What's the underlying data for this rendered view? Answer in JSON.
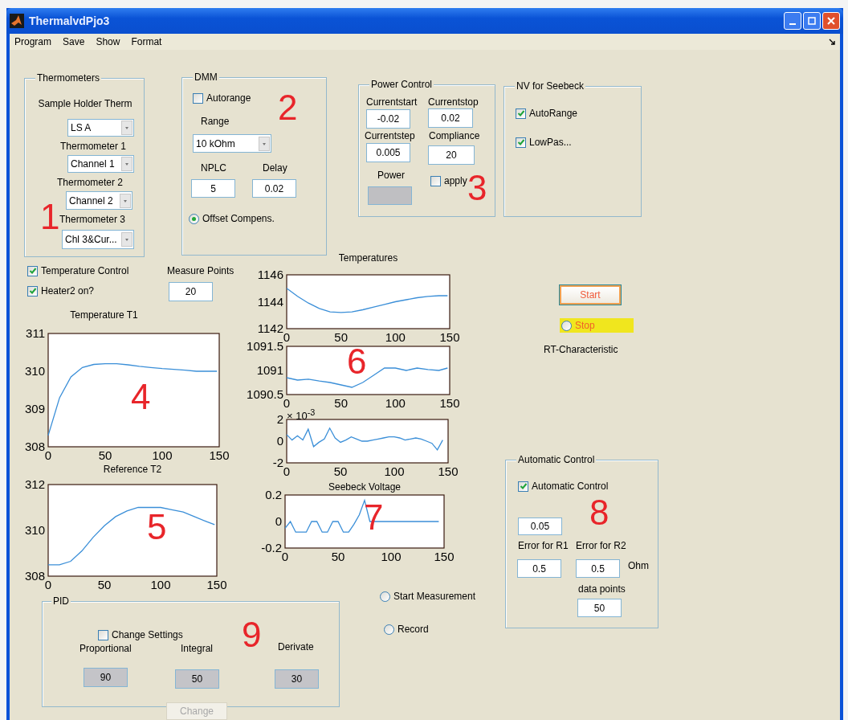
{
  "window": {
    "title": "ThermalvdPjo3"
  },
  "menu": [
    "Program",
    "Save",
    "Show",
    "Format"
  ],
  "thermometers": {
    "title": "Thermometers",
    "fields": [
      {
        "label": "Sample Holder Therm",
        "value": "LS A"
      },
      {
        "label": "Thermometer 1",
        "value": "Channel 1"
      },
      {
        "label": "Thermometer 2",
        "value": "Channel 2"
      },
      {
        "label": "Thermometer 3",
        "value": "Chl 3&Cur..."
      }
    ]
  },
  "dmm": {
    "title": "DMM",
    "autorange": {
      "label": "Autorange",
      "checked": false
    },
    "range": {
      "label": "Range",
      "value": "10 kOhm"
    },
    "nplc": {
      "label": "NPLC",
      "value": "5"
    },
    "delay": {
      "label": "Delay",
      "value": "0.02"
    },
    "offset": {
      "label": "Offset Compens.",
      "selected": true
    }
  },
  "power_control": {
    "title": "Power Control",
    "fields": [
      {
        "label": "Currentstart",
        "value": "-0.02"
      },
      {
        "label": "Currentstop",
        "value": "0.02"
      },
      {
        "label": "Currentstep",
        "value": "0.005"
      },
      {
        "label": "Compliance",
        "value": "20"
      }
    ],
    "power_label": "Power",
    "apply": {
      "label": "apply",
      "checked": false
    }
  },
  "nv_seebeck": {
    "title": "NV for Seebeck",
    "options": [
      {
        "label": "AutoRange",
        "checked": true
      },
      {
        "label": "LowPas...",
        "checked": true
      }
    ]
  },
  "temperature_control": {
    "label": "Temperature Control",
    "checked": true
  },
  "heater2": {
    "label": "Heater2 on?",
    "checked": true
  },
  "measure_points": {
    "label": "Measure Points",
    "value": "20"
  },
  "plots": [
    {
      "chart_data": {
        "type": "line",
        "title": "Temperature T1",
        "x": [
          0,
          10,
          20,
          30,
          40,
          50,
          60,
          70,
          80,
          90,
          100,
          110,
          120,
          130,
          140,
          148
        ],
        "series": [
          {
            "color": "#3b8fd8",
            "values": [
              308.3,
              309.3,
              309.85,
              310.1,
              310.18,
              310.2,
              310.2,
              310.17,
              310.13,
              310.1,
              310.07,
              310.05,
              310.03,
              310.0,
              310.0,
              310.0
            ]
          }
        ],
        "xlim": [
          0,
          150
        ],
        "ylim": [
          308,
          311
        ],
        "xticks": [
          0,
          50,
          100,
          150
        ],
        "yticks": [
          308,
          309,
          310,
          311
        ]
      }
    },
    {
      "chart_data": {
        "type": "line",
        "title": "Reference T2",
        "x": [
          0,
          10,
          20,
          30,
          40,
          50,
          60,
          70,
          80,
          90,
          100,
          110,
          120,
          130,
          140,
          148
        ],
        "series": [
          {
            "color": "#3b8fd8",
            "values": [
              308.5,
              308.5,
              308.65,
              309.1,
              309.7,
              310.2,
              310.6,
              310.85,
              311.0,
              311.0,
              311.0,
              310.9,
              310.8,
              310.6,
              310.4,
              310.25
            ]
          }
        ],
        "xlim": [
          0,
          150
        ],
        "ylim": [
          308,
          312
        ],
        "xticks": [
          0,
          50,
          100,
          150
        ],
        "yticks": [
          308,
          310,
          312
        ]
      }
    },
    {
      "chart_data": {
        "type": "line",
        "title": "Temperatures",
        "x": [
          0,
          10,
          20,
          30,
          40,
          50,
          60,
          70,
          80,
          90,
          100,
          110,
          120,
          130,
          140,
          148
        ],
        "series": [
          {
            "color": "#3b8fd8",
            "values": [
              1145.0,
              1144.4,
              1143.9,
              1143.5,
              1143.25,
              1143.2,
              1143.25,
              1143.4,
              1143.6,
              1143.8,
              1144.0,
              1144.15,
              1144.3,
              1144.4,
              1144.45,
              1144.45
            ]
          }
        ],
        "xlim": [
          0,
          150
        ],
        "ylim": [
          1142,
          1146
        ],
        "xticks": [
          0,
          50,
          100,
          150
        ],
        "yticks": [
          1142,
          1144,
          1146
        ]
      }
    },
    {
      "chart_data": {
        "type": "line",
        "x": [
          0,
          10,
          20,
          30,
          40,
          50,
          60,
          70,
          80,
          90,
          100,
          110,
          120,
          130,
          140,
          148
        ],
        "series": [
          {
            "color": "#3b8fd8",
            "values": [
              1090.85,
              1090.8,
              1090.82,
              1090.78,
              1090.75,
              1090.7,
              1090.65,
              1090.75,
              1090.9,
              1091.05,
              1091.05,
              1091.0,
              1091.05,
              1091.02,
              1091.0,
              1091.05
            ]
          }
        ],
        "xlim": [
          0,
          150
        ],
        "ylim": [
          1090.5,
          1091.5
        ],
        "xticks": [
          0,
          50,
          100,
          150
        ],
        "yticks": [
          1090.5,
          1091,
          1091.5
        ]
      }
    },
    {
      "exponent": "× 10$^{-3}$",
      "chart_data": {
        "type": "line",
        "x": [
          0,
          5,
          10,
          15,
          20,
          25,
          30,
          35,
          40,
          45,
          50,
          55,
          60,
          65,
          70,
          75,
          80,
          85,
          90,
          95,
          100,
          105,
          110,
          115,
          120,
          125,
          130,
          135,
          140,
          145
        ],
        "series": [
          {
            "color": "#3b8fd8",
            "values": [
              0.6,
              0.1,
              0.5,
              0.1,
              1.1,
              -0.5,
              -0.1,
              0.2,
              1.2,
              0.3,
              -0.1,
              0.1,
              0.4,
              0.2,
              0.0,
              0.0,
              0.1,
              0.2,
              0.3,
              0.4,
              0.4,
              0.3,
              0.1,
              0.2,
              0.3,
              0.2,
              0.0,
              -0.2,
              -0.8,
              0.1
            ]
          }
        ],
        "xlim": [
          0,
          150
        ],
        "ylim": [
          -2,
          2
        ],
        "xticks": [
          0,
          50,
          100,
          150
        ],
        "yticks": [
          -2,
          0,
          2
        ]
      }
    },
    {
      "chart_data": {
        "type": "line",
        "title": "Seebeck Voltage",
        "x": [
          0,
          5,
          10,
          15,
          20,
          25,
          30,
          35,
          40,
          45,
          50,
          55,
          60,
          65,
          70,
          75,
          80,
          85,
          90,
          95,
          100,
          105,
          110,
          115,
          120,
          125,
          130,
          135,
          140,
          145
        ],
        "series": [
          {
            "color": "#3b8fd8",
            "values": [
              -0.05,
              0,
              -0.08,
              -0.08,
              -0.08,
              0,
              0,
              -0.08,
              -0.08,
              0,
              0,
              -0.08,
              -0.08,
              -0.02,
              0.05,
              0.16,
              0,
              0,
              0,
              0,
              0,
              0,
              0,
              0,
              0,
              0,
              0,
              0,
              0,
              0
            ]
          }
        ],
        "xlim": [
          0,
          150
        ],
        "ylim": [
          -0.2,
          0.2
        ],
        "xticks": [
          0,
          50,
          100,
          150
        ],
        "yticks": [
          -0.2,
          0,
          0.2
        ]
      }
    }
  ],
  "start_button": {
    "label": "Start"
  },
  "stop": {
    "label": "Stop",
    "selected": false
  },
  "rt_label": "RT-Characteristic",
  "automatic_control": {
    "title": "Automatic Control",
    "checkbox": {
      "label": "Automatic Control",
      "checked": true
    },
    "threshold": "0.05",
    "error_r1": {
      "label": "Error for R1",
      "value": "0.5"
    },
    "error_r2": {
      "label": "Error for R2",
      "value": "0.5"
    },
    "unit": "Ohm",
    "data_points": {
      "label": "data points",
      "value": "50"
    }
  },
  "measurement": [
    {
      "label": "Start Measurement",
      "selected": false
    },
    {
      "label": "Record",
      "selected": false
    }
  ],
  "pid": {
    "title": "PID",
    "change_settings": {
      "label": "Change Settings",
      "checked": false
    },
    "params": [
      {
        "label": "Proportional",
        "value": "90"
      },
      {
        "label": "Integral",
        "value": "50"
      },
      {
        "label": "Derivate",
        "value": "30"
      }
    ],
    "change_button": {
      "label": "Change",
      "disabled": true
    }
  },
  "annotations": [
    "1",
    "2",
    "3",
    "4",
    "5",
    "6",
    "7",
    "8",
    "9"
  ]
}
